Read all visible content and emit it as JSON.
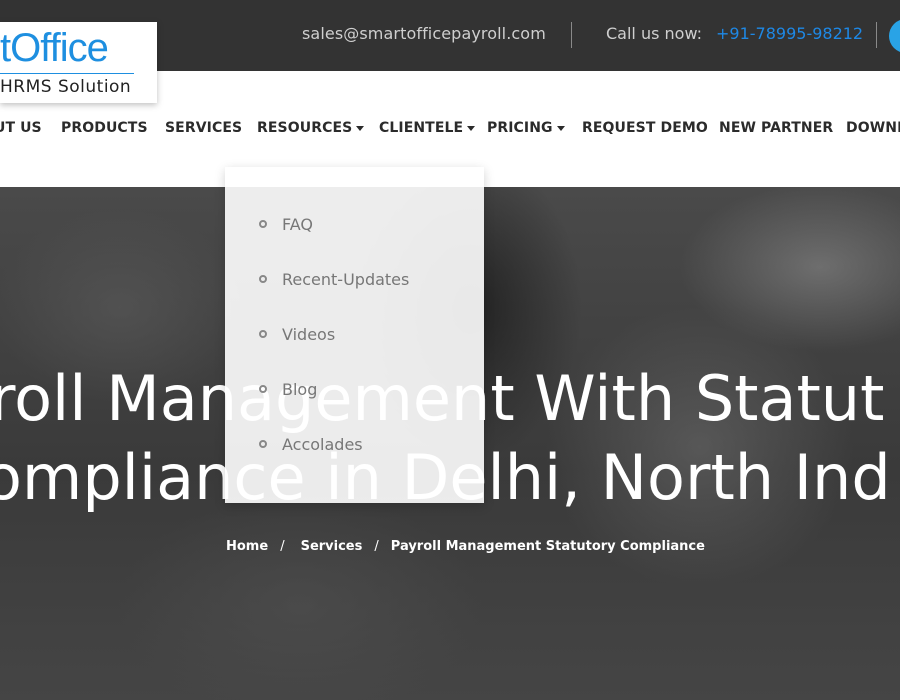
{
  "topbar": {
    "email": "sales@smartofficepayroll.com",
    "call_label": "Call us now:",
    "phone": "+91-78995-98212"
  },
  "logo": {
    "brand": "tOffice",
    "tagline": "HRMS Solution"
  },
  "nav": {
    "items": [
      {
        "label": "UT US",
        "dropdown": false
      },
      {
        "label": "PRODUCTS",
        "dropdown": false
      },
      {
        "label": "SERVICES",
        "dropdown": false
      },
      {
        "label": "RESOURCES",
        "dropdown": true
      },
      {
        "label": "CLIENTELE",
        "dropdown": true
      },
      {
        "label": "PRICING",
        "dropdown": true
      },
      {
        "label": "REQUEST DEMO",
        "dropdown": false
      },
      {
        "label": "NEW PARTNER",
        "dropdown": false
      },
      {
        "label": "DOWNL",
        "dropdown": false
      }
    ]
  },
  "resources_menu": {
    "items": [
      "FAQ",
      "Recent-Updates",
      "Videos",
      "Blog",
      "Accolades"
    ]
  },
  "hero": {
    "title_line1": "roll Management With Statut",
    "title_line2": "ompliance in Delhi, North Ind"
  },
  "breadcrumb": {
    "items": [
      "Home",
      "Services",
      "Payroll Management Statutory Compliance"
    ],
    "separator": "/"
  }
}
